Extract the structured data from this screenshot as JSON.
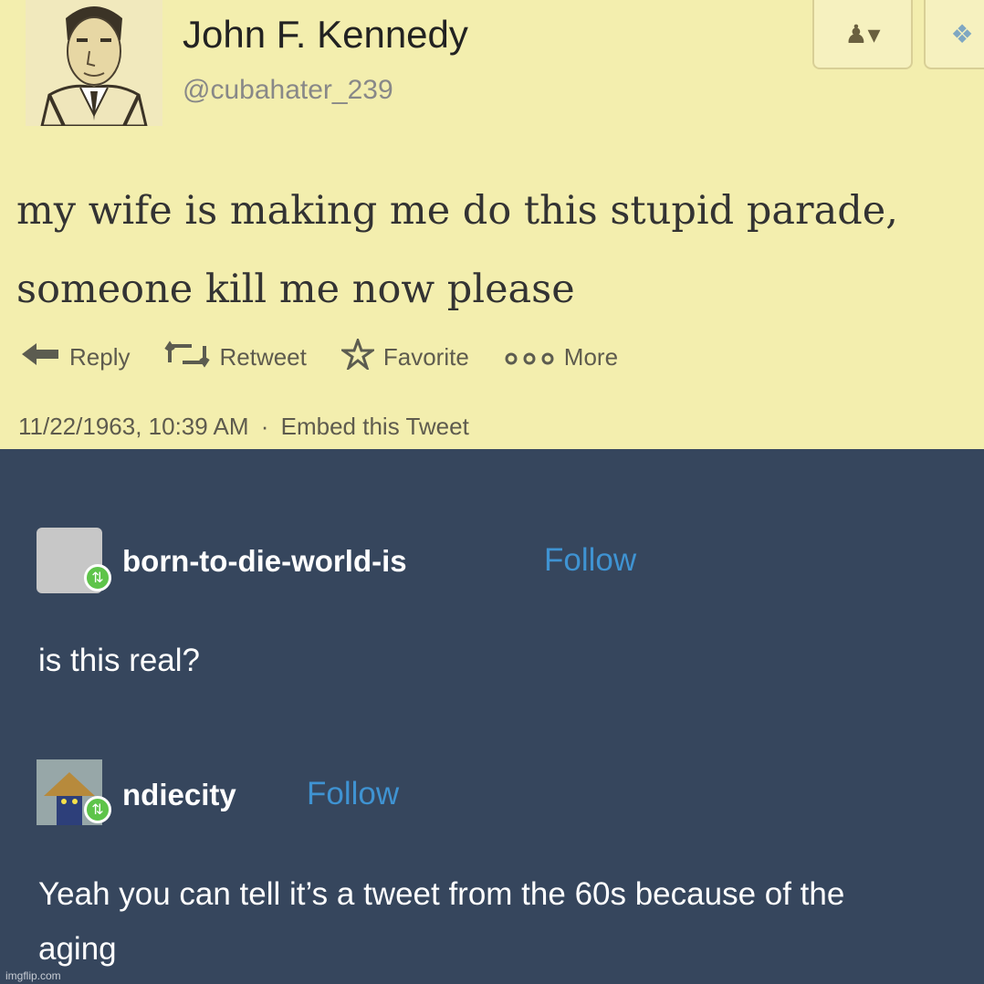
{
  "tweet": {
    "name": "John F. Kennedy",
    "handle": "@cubahater_239",
    "text": "my wife is making me do this stupid parade, someone kill me now please",
    "actions": [
      {
        "icon": "reply-arrow-icon",
        "label": "Reply"
      },
      {
        "icon": "retweet-icon",
        "label": "Retweet"
      },
      {
        "icon": "star-icon",
        "label": "Favorite"
      },
      {
        "icon": "more-dots-icon",
        "label": "More"
      }
    ],
    "timestamp": "11/22/1963, 10:39 AM",
    "separator": "·",
    "embed_label": "Embed this Tweet",
    "header_icons": [
      "follow-person-icon",
      "twitter-bird-icon"
    ]
  },
  "reblogs": [
    {
      "username": "born-to-die-world-is",
      "follow_label": "Follow",
      "comment": "is this real?"
    },
    {
      "username": "ndiecity",
      "follow_label": "Follow",
      "comment": "Yeah you can tell it’s a tweet from the 60s because of the aging"
    }
  ],
  "watermark": "imgflip.com",
  "colors": {
    "tweet_bg": "#f3eeae",
    "dashboard_bg": "#36465d",
    "follow_link": "#3f93d2",
    "reblog_badge": "#5ec44a"
  }
}
